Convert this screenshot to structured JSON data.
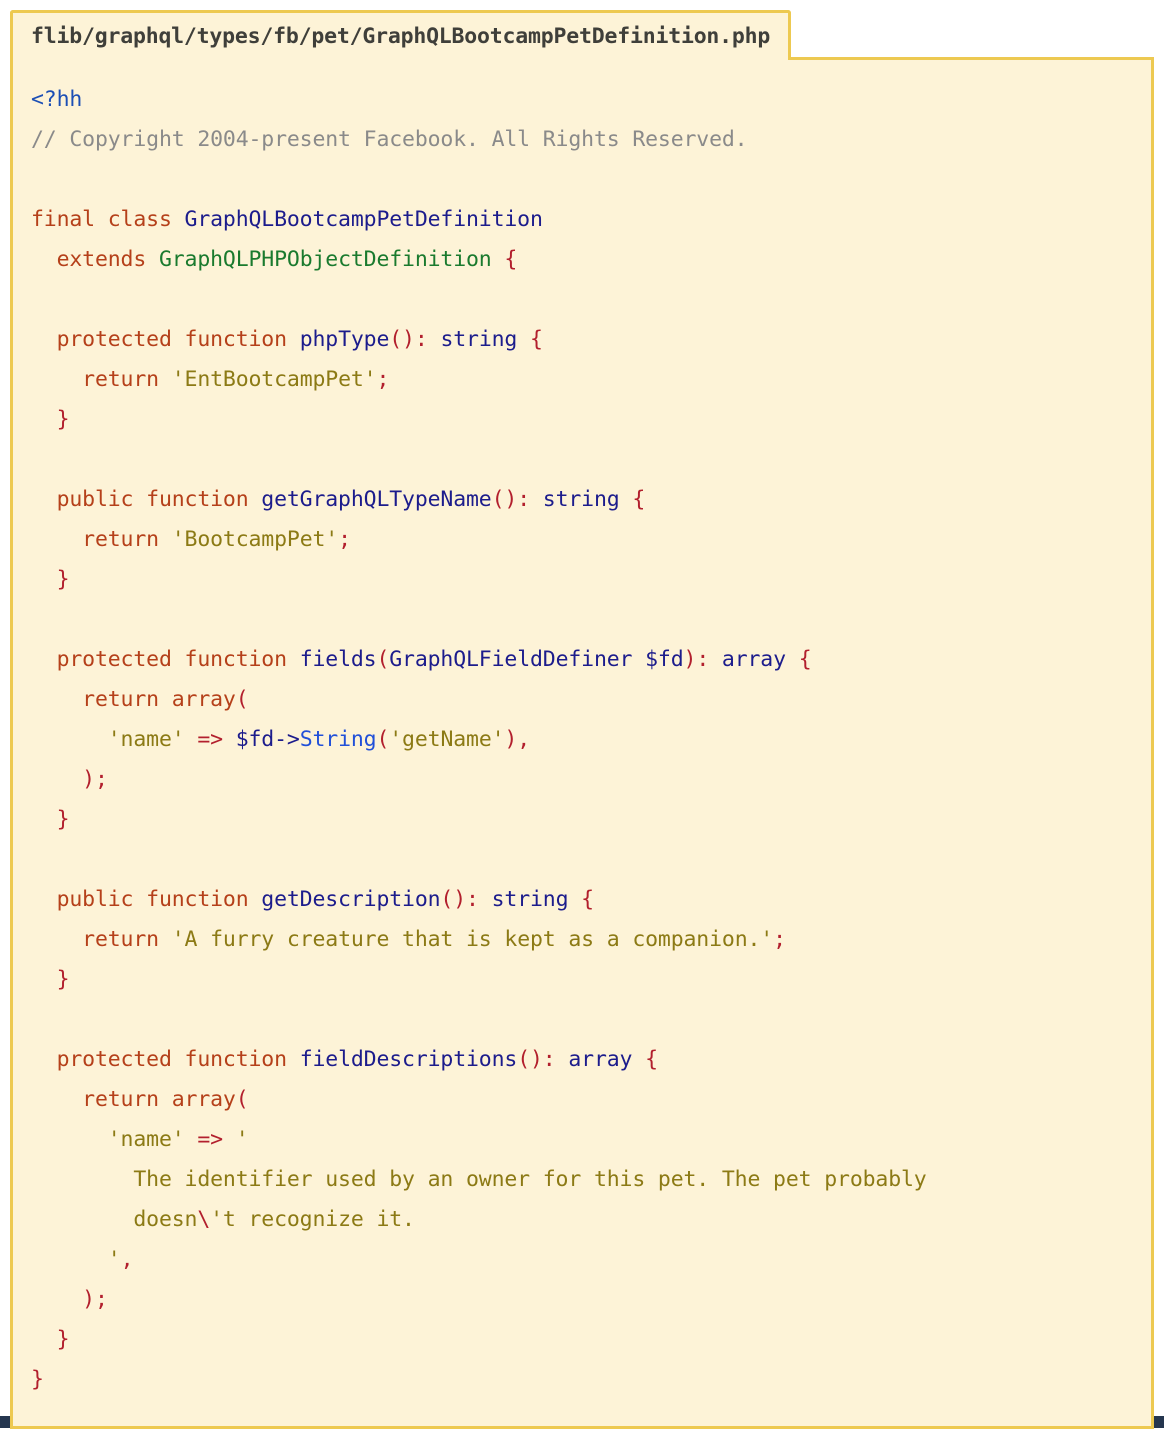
{
  "file": {
    "path": "flib/graphql/types/fb/pet/GraphQLBootcampPetDefinition.php",
    "language": "hack-php"
  },
  "theme": {
    "background": "#fdf3d7",
    "border": "#edc951",
    "keyword": "#b5401a",
    "class_name": "#1c1c8c",
    "parent_class": "#1a7a2e",
    "punctuation": "#b21f2d",
    "string": "#8c7a15",
    "comment": "#8a8a8a",
    "open_tag": "#1c4fb5",
    "method_call": "#2150d8",
    "header_text": "#3f3f3a",
    "bottom_band": "#25364f"
  },
  "code": {
    "lines": [
      {
        "n": 1,
        "tokens": [
          {
            "t": "<?hh",
            "c": "t-tag"
          }
        ]
      },
      {
        "n": 2,
        "tokens": [
          {
            "t": "// Copyright 2004-present Facebook. All Rights Reserved.",
            "c": "t-cmt"
          }
        ]
      },
      {
        "n": 3,
        "tokens": []
      },
      {
        "n": 4,
        "tokens": [
          {
            "t": "final class ",
            "c": "t-kw"
          },
          {
            "t": "GraphQLBootcampPetDefinition",
            "c": "t-cls"
          }
        ]
      },
      {
        "n": 5,
        "tokens": [
          {
            "t": "  extends ",
            "c": "t-kw"
          },
          {
            "t": "GraphQLPHPObjectDefinition",
            "c": "t-parent"
          },
          {
            "t": " {",
            "c": "t-punc"
          }
        ]
      },
      {
        "n": 6,
        "tokens": []
      },
      {
        "n": 7,
        "tokens": [
          {
            "t": "  protected function ",
            "c": "t-kw"
          },
          {
            "t": "phpType",
            "c": "t-fn"
          },
          {
            "t": "()",
            "c": "t-punc"
          },
          {
            "t": ": ",
            "c": "t-punc"
          },
          {
            "t": "string",
            "c": "t-type"
          },
          {
            "t": " {",
            "c": "t-punc"
          }
        ]
      },
      {
        "n": 8,
        "tokens": [
          {
            "t": "    return ",
            "c": "t-kw"
          },
          {
            "t": "'EntBootcampPet'",
            "c": "t-str"
          },
          {
            "t": ";",
            "c": "t-punc"
          }
        ]
      },
      {
        "n": 9,
        "tokens": [
          {
            "t": "  }",
            "c": "t-punc"
          }
        ]
      },
      {
        "n": 10,
        "tokens": []
      },
      {
        "n": 11,
        "tokens": [
          {
            "t": "  public function ",
            "c": "t-kw"
          },
          {
            "t": "getGraphQLTypeName",
            "c": "t-fn"
          },
          {
            "t": "()",
            "c": "t-punc"
          },
          {
            "t": ": ",
            "c": "t-punc"
          },
          {
            "t": "string",
            "c": "t-type"
          },
          {
            "t": " {",
            "c": "t-punc"
          }
        ]
      },
      {
        "n": 12,
        "tokens": [
          {
            "t": "    return ",
            "c": "t-kw"
          },
          {
            "t": "'BootcampPet'",
            "c": "t-str"
          },
          {
            "t": ";",
            "c": "t-punc"
          }
        ]
      },
      {
        "n": 13,
        "tokens": [
          {
            "t": "  }",
            "c": "t-punc"
          }
        ]
      },
      {
        "n": 14,
        "tokens": []
      },
      {
        "n": 15,
        "tokens": [
          {
            "t": "  protected function ",
            "c": "t-kw"
          },
          {
            "t": "fields",
            "c": "t-fn"
          },
          {
            "t": "(",
            "c": "t-punc"
          },
          {
            "t": "GraphQLFieldDefiner",
            "c": "t-cls"
          },
          {
            "t": " ",
            "c": "t-punc"
          },
          {
            "t": "$fd",
            "c": "t-var"
          },
          {
            "t": ")",
            "c": "t-punc"
          },
          {
            "t": ": ",
            "c": "t-punc"
          },
          {
            "t": "array",
            "c": "t-type"
          },
          {
            "t": " {",
            "c": "t-punc"
          }
        ]
      },
      {
        "n": 16,
        "tokens": [
          {
            "t": "    return array",
            "c": "t-kw"
          },
          {
            "t": "(",
            "c": "t-punc"
          }
        ]
      },
      {
        "n": 17,
        "tokens": [
          {
            "t": "      ",
            "c": "t-punc"
          },
          {
            "t": "'name'",
            "c": "t-str"
          },
          {
            "t": " => ",
            "c": "t-punc"
          },
          {
            "t": "$fd->",
            "c": "t-var"
          },
          {
            "t": "String",
            "c": "t-call"
          },
          {
            "t": "(",
            "c": "t-punc"
          },
          {
            "t": "'getName'",
            "c": "t-str"
          },
          {
            "t": "),",
            "c": "t-punc"
          }
        ]
      },
      {
        "n": 18,
        "tokens": [
          {
            "t": "    );",
            "c": "t-punc"
          }
        ]
      },
      {
        "n": 19,
        "tokens": [
          {
            "t": "  }",
            "c": "t-punc"
          }
        ]
      },
      {
        "n": 20,
        "tokens": []
      },
      {
        "n": 21,
        "tokens": [
          {
            "t": "  public function ",
            "c": "t-kw"
          },
          {
            "t": "getDescription",
            "c": "t-fn"
          },
          {
            "t": "()",
            "c": "t-punc"
          },
          {
            "t": ": ",
            "c": "t-punc"
          },
          {
            "t": "string",
            "c": "t-type"
          },
          {
            "t": " {",
            "c": "t-punc"
          }
        ]
      },
      {
        "n": 22,
        "tokens": [
          {
            "t": "    return ",
            "c": "t-kw"
          },
          {
            "t": "'A furry creature that is kept as a companion.'",
            "c": "t-str"
          },
          {
            "t": ";",
            "c": "t-punc"
          }
        ]
      },
      {
        "n": 23,
        "tokens": [
          {
            "t": "  }",
            "c": "t-punc"
          }
        ]
      },
      {
        "n": 24,
        "tokens": []
      },
      {
        "n": 25,
        "tokens": [
          {
            "t": "  protected function ",
            "c": "t-kw"
          },
          {
            "t": "fieldDescriptions",
            "c": "t-fn"
          },
          {
            "t": "()",
            "c": "t-punc"
          },
          {
            "t": ": ",
            "c": "t-punc"
          },
          {
            "t": "array",
            "c": "t-type"
          },
          {
            "t": " {",
            "c": "t-punc"
          }
        ]
      },
      {
        "n": 26,
        "tokens": [
          {
            "t": "    return array",
            "c": "t-kw"
          },
          {
            "t": "(",
            "c": "t-punc"
          }
        ]
      },
      {
        "n": 27,
        "tokens": [
          {
            "t": "      ",
            "c": "t-punc"
          },
          {
            "t": "'name'",
            "c": "t-str"
          },
          {
            "t": " => ",
            "c": "t-punc"
          },
          {
            "t": "'",
            "c": "t-str"
          }
        ]
      },
      {
        "n": 28,
        "tokens": [
          {
            "t": "        The identifier used by an owner for this pet. The pet probably",
            "c": "t-str"
          }
        ]
      },
      {
        "n": 29,
        "tokens": [
          {
            "t": "        doesn",
            "c": "t-str"
          },
          {
            "t": "\\",
            "c": "t-esc"
          },
          {
            "t": "'t recognize it.",
            "c": "t-str"
          }
        ]
      },
      {
        "n": 30,
        "tokens": [
          {
            "t": "      '",
            "c": "t-str"
          },
          {
            "t": ",",
            "c": "t-punc"
          }
        ]
      },
      {
        "n": 31,
        "tokens": [
          {
            "t": "    );",
            "c": "t-punc"
          }
        ]
      },
      {
        "n": 32,
        "tokens": [
          {
            "t": "  }",
            "c": "t-punc"
          }
        ]
      },
      {
        "n": 33,
        "tokens": [
          {
            "t": "}",
            "c": "t-punc"
          }
        ]
      }
    ]
  }
}
